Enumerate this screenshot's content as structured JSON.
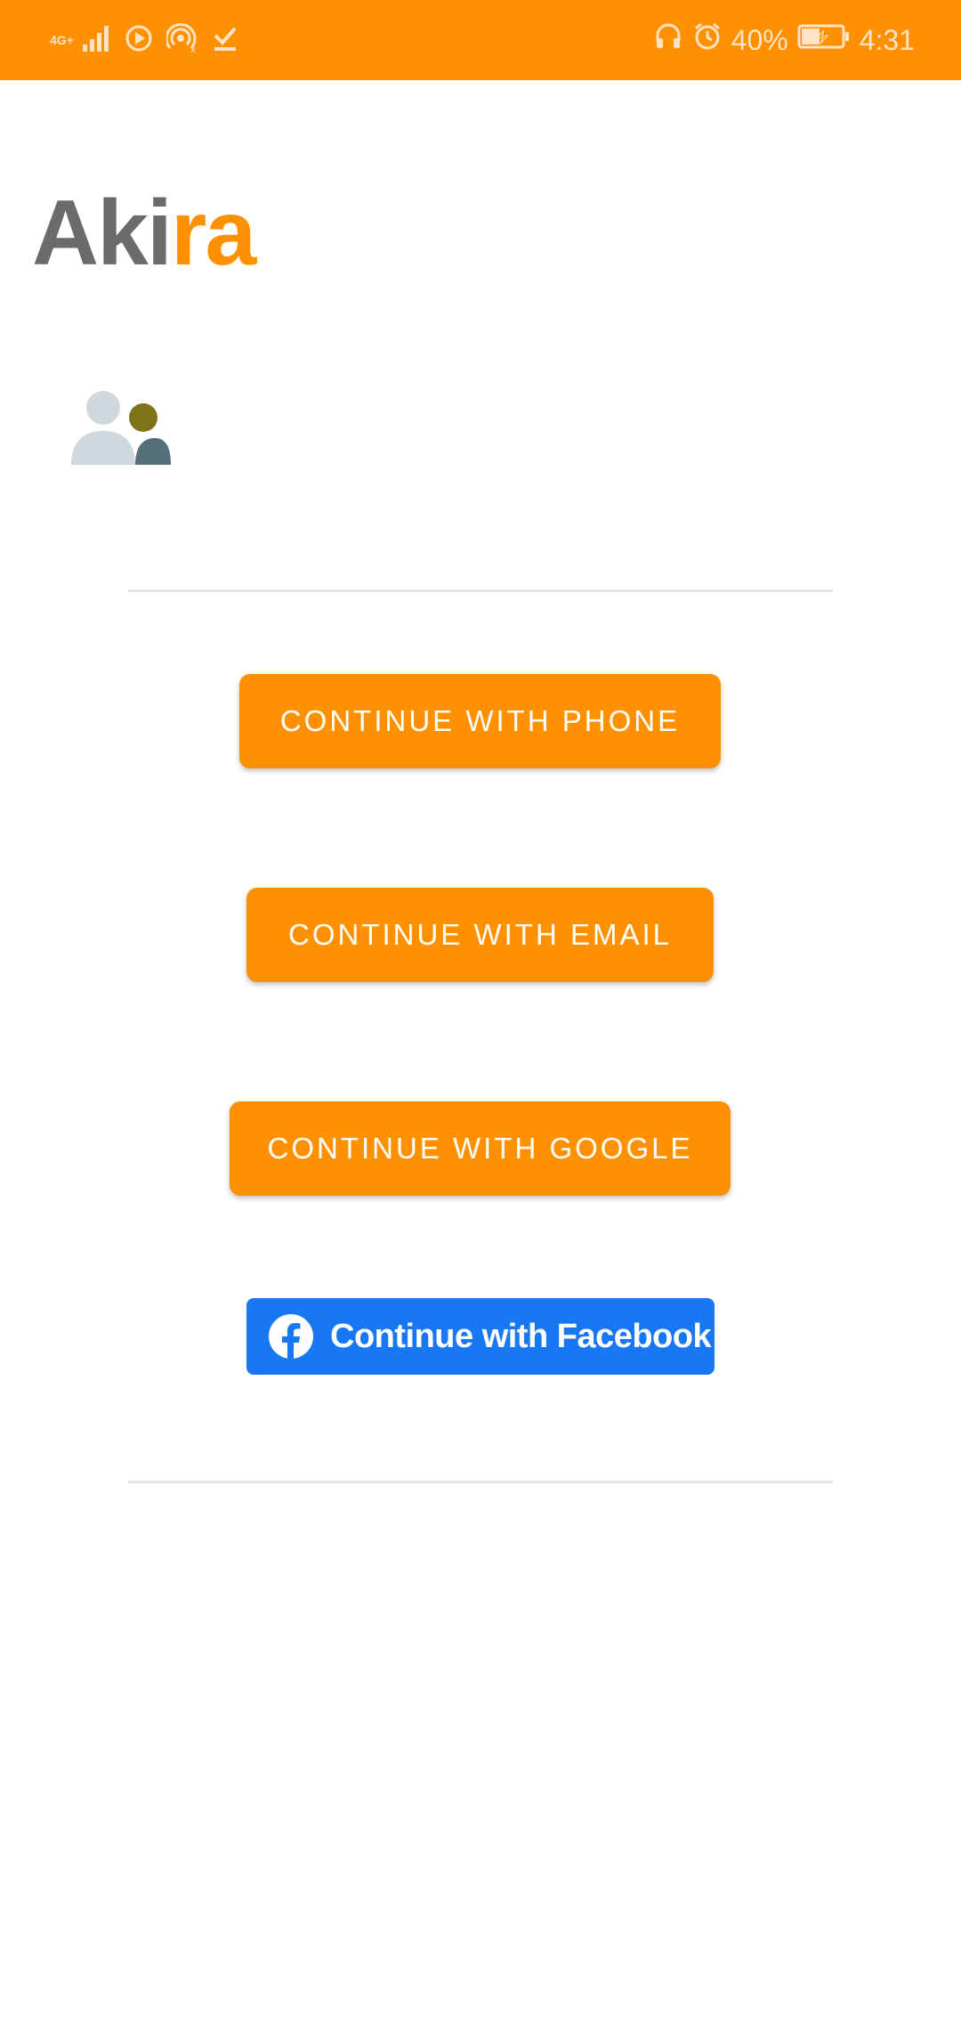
{
  "status_bar": {
    "network": "4G+",
    "battery": "40%",
    "time": "4:31",
    "icons": [
      "signal-icon",
      "play-icon",
      "hotspot-icon",
      "download-done-icon",
      "headset-icon",
      "alarm-icon",
      "battery-charging-icon"
    ]
  },
  "app": {
    "logo_part1": "Aki",
    "logo_part2": "ra"
  },
  "buttons": {
    "phone": "CONTINUE WITH PHONE",
    "email": "CONTINUE WITH EMAIL",
    "google": "CONTINUE WITH GOOGLE",
    "facebook": "Continue with Facebook"
  },
  "colors": {
    "accent": "#ff9100",
    "facebook": "#1877f2",
    "logo_gray": "#6b6b6b"
  }
}
